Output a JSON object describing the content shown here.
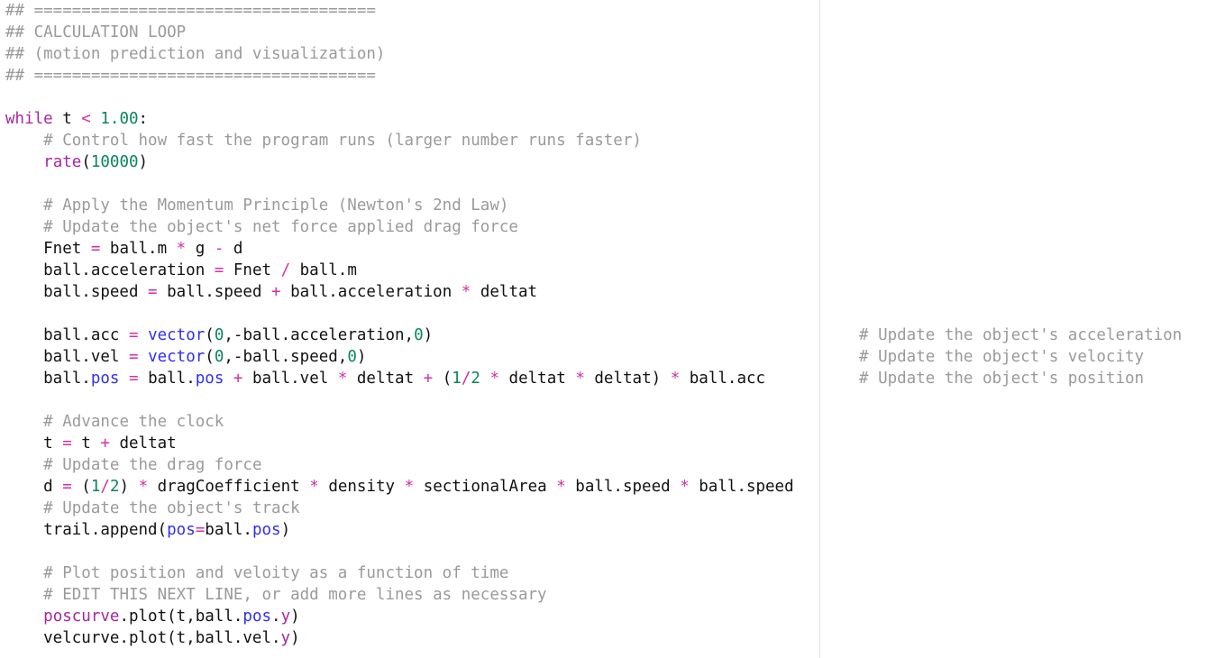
{
  "editor": {
    "lines": [
      [
        {
          "t": "## ====================================",
          "k": "c"
        }
      ],
      [
        {
          "t": "## CALCULATION LOOP",
          "k": "c"
        }
      ],
      [
        {
          "t": "## (motion prediction and visualization)",
          "k": "c"
        }
      ],
      [
        {
          "t": "## ====================================",
          "k": "c"
        }
      ],
      [],
      [
        {
          "t": "while",
          "k": "k"
        },
        {
          "t": " t ",
          "k": "v"
        },
        {
          "t": "<",
          "k": "o"
        },
        {
          "t": " ",
          "k": "v"
        },
        {
          "t": "1.00",
          "k": "n"
        },
        {
          "t": ":",
          "k": "v"
        }
      ],
      [
        {
          "t": "    ",
          "k": "v"
        },
        {
          "t": "# Control how fast the program runs (larger number runs faster)",
          "k": "c"
        }
      ],
      [
        {
          "t": "    ",
          "k": "v"
        },
        {
          "t": "rate",
          "k": "k"
        },
        {
          "t": "(",
          "k": "v"
        },
        {
          "t": "10000",
          "k": "n"
        },
        {
          "t": ")",
          "k": "v"
        }
      ],
      [],
      [
        {
          "t": "    ",
          "k": "v"
        },
        {
          "t": "# Apply the Momentum Principle (Newton's 2nd Law)",
          "k": "c"
        }
      ],
      [
        {
          "t": "    ",
          "k": "v"
        },
        {
          "t": "# Update the object's net force applied drag force",
          "k": "c"
        }
      ],
      [
        {
          "t": "    Fnet ",
          "k": "v"
        },
        {
          "t": "=",
          "k": "o"
        },
        {
          "t": " ball.m ",
          "k": "v"
        },
        {
          "t": "*",
          "k": "o"
        },
        {
          "t": " g ",
          "k": "v"
        },
        {
          "t": "-",
          "k": "o"
        },
        {
          "t": " d",
          "k": "v"
        }
      ],
      [
        {
          "t": "    ball.acceleration ",
          "k": "v"
        },
        {
          "t": "=",
          "k": "o"
        },
        {
          "t": " Fnet ",
          "k": "v"
        },
        {
          "t": "/",
          "k": "o"
        },
        {
          "t": " ball.m",
          "k": "v"
        }
      ],
      [
        {
          "t": "    ball.speed ",
          "k": "v"
        },
        {
          "t": "=",
          "k": "o"
        },
        {
          "t": " ball.speed ",
          "k": "v"
        },
        {
          "t": "+",
          "k": "o"
        },
        {
          "t": " ball.acceleration ",
          "k": "v"
        },
        {
          "t": "*",
          "k": "o"
        },
        {
          "t": " deltat",
          "k": "v"
        }
      ],
      [],
      [
        {
          "t": "    ball.acc ",
          "k": "v"
        },
        {
          "t": "=",
          "k": "o"
        },
        {
          "t": " ",
          "k": "v"
        },
        {
          "t": "vector",
          "k": "b"
        },
        {
          "t": "(",
          "k": "v"
        },
        {
          "t": "0",
          "k": "n"
        },
        {
          "t": ",-ball.acceleration,",
          "k": "v"
        },
        {
          "t": "0",
          "k": "n"
        },
        {
          "t": ")",
          "k": "v"
        }
      ],
      [
        {
          "t": "    ball.vel ",
          "k": "v"
        },
        {
          "t": "=",
          "k": "o"
        },
        {
          "t": " ",
          "k": "v"
        },
        {
          "t": "vector",
          "k": "b"
        },
        {
          "t": "(",
          "k": "v"
        },
        {
          "t": "0",
          "k": "n"
        },
        {
          "t": ",-ball.speed,",
          "k": "v"
        },
        {
          "t": "0",
          "k": "n"
        },
        {
          "t": ")",
          "k": "v"
        }
      ],
      [
        {
          "t": "    ball.",
          "k": "v"
        },
        {
          "t": "pos",
          "k": "b"
        },
        {
          "t": " ",
          "k": "v"
        },
        {
          "t": "=",
          "k": "o"
        },
        {
          "t": " ball.",
          "k": "v"
        },
        {
          "t": "pos",
          "k": "b"
        },
        {
          "t": " ",
          "k": "v"
        },
        {
          "t": "+",
          "k": "o"
        },
        {
          "t": " ball.vel ",
          "k": "v"
        },
        {
          "t": "*",
          "k": "o"
        },
        {
          "t": " deltat ",
          "k": "v"
        },
        {
          "t": "+",
          "k": "o"
        },
        {
          "t": " (",
          "k": "v"
        },
        {
          "t": "1",
          "k": "n"
        },
        {
          "t": "/",
          "k": "o"
        },
        {
          "t": "2",
          "k": "n"
        },
        {
          "t": " ",
          "k": "v"
        },
        {
          "t": "*",
          "k": "o"
        },
        {
          "t": " deltat ",
          "k": "v"
        },
        {
          "t": "*",
          "k": "o"
        },
        {
          "t": " deltat) ",
          "k": "v"
        },
        {
          "t": "*",
          "k": "o"
        },
        {
          "t": " ball.acc",
          "k": "v"
        }
      ],
      [],
      [
        {
          "t": "    ",
          "k": "v"
        },
        {
          "t": "# Advance the clock",
          "k": "c"
        }
      ],
      [
        {
          "t": "    t ",
          "k": "v"
        },
        {
          "t": "=",
          "k": "o"
        },
        {
          "t": " t ",
          "k": "v"
        },
        {
          "t": "+",
          "k": "o"
        },
        {
          "t": " deltat",
          "k": "v"
        }
      ],
      [
        {
          "t": "    ",
          "k": "v"
        },
        {
          "t": "# Update the drag force",
          "k": "c"
        }
      ],
      [
        {
          "t": "    d ",
          "k": "v"
        },
        {
          "t": "=",
          "k": "o"
        },
        {
          "t": " (",
          "k": "v"
        },
        {
          "t": "1",
          "k": "n"
        },
        {
          "t": "/",
          "k": "o"
        },
        {
          "t": "2",
          "k": "n"
        },
        {
          "t": ") ",
          "k": "v"
        },
        {
          "t": "*",
          "k": "o"
        },
        {
          "t": " dragCoefficient ",
          "k": "v"
        },
        {
          "t": "*",
          "k": "o"
        },
        {
          "t": " density ",
          "k": "v"
        },
        {
          "t": "*",
          "k": "o"
        },
        {
          "t": " sectionalArea ",
          "k": "v"
        },
        {
          "t": "*",
          "k": "o"
        },
        {
          "t": " ball.speed ",
          "k": "v"
        },
        {
          "t": "*",
          "k": "o"
        },
        {
          "t": " ball.speed",
          "k": "v"
        }
      ],
      [
        {
          "t": "    ",
          "k": "v"
        },
        {
          "t": "# Update the object's track",
          "k": "c"
        }
      ],
      [
        {
          "t": "    trail.append(",
          "k": "v"
        },
        {
          "t": "pos",
          "k": "b"
        },
        {
          "t": "=",
          "k": "o"
        },
        {
          "t": "ball.",
          "k": "v"
        },
        {
          "t": "pos",
          "k": "b"
        },
        {
          "t": ")",
          "k": "v"
        }
      ],
      [],
      [
        {
          "t": "    ",
          "k": "v"
        },
        {
          "t": "# Plot position and veloity as a function of time",
          "k": "c"
        }
      ],
      [
        {
          "t": "    ",
          "k": "v"
        },
        {
          "t": "# EDIT THIS NEXT LINE, or add more lines as necessary",
          "k": "c"
        }
      ],
      [
        {
          "t": "    ",
          "k": "v"
        },
        {
          "t": "poscurve",
          "k": "k"
        },
        {
          "t": ".plot(t,ball.",
          "k": "v"
        },
        {
          "t": "pos",
          "k": "b"
        },
        {
          "t": ".",
          "k": "v"
        },
        {
          "t": "y",
          "k": "k"
        },
        {
          "t": ")",
          "k": "v"
        }
      ],
      [
        {
          "t": "    velcurve.plot(t,ball.vel.",
          "k": "v"
        },
        {
          "t": "y",
          "k": "k"
        },
        {
          "t": ")",
          "k": "v"
        }
      ]
    ],
    "inline_comments": [
      "# Update the object's acceleration",
      "# Update the object's velocity",
      "# Update the object's position"
    ]
  },
  "colors": {
    "comment": "#9a9a9a",
    "keyword": "#a626a4",
    "number": "#098658",
    "operator": "#d62fa5",
    "builtin": "#2f2ff0",
    "text": "#111111",
    "ruler": "#e1e1e1",
    "background": "#ffffff"
  }
}
